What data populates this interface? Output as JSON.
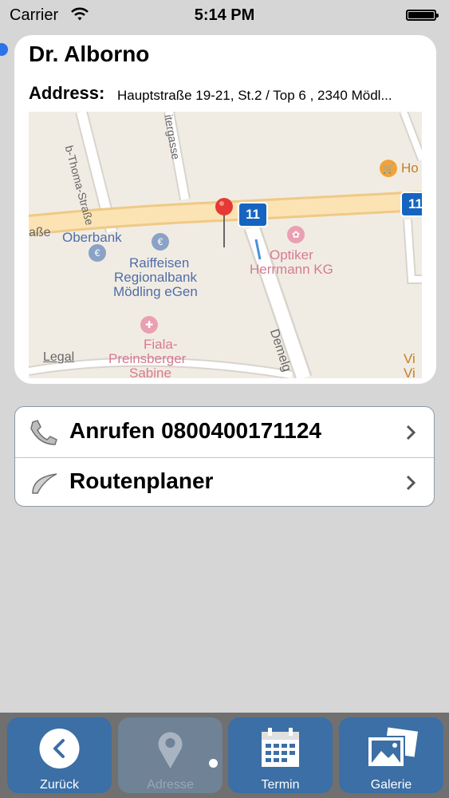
{
  "status_bar": {
    "carrier": "Carrier",
    "time": "5:14 PM"
  },
  "card": {
    "title": "Dr. Alborno",
    "address_label": "Address:",
    "address_value": "Hauptstraße 19-21, St.2 / Top 6 , 2340 Mödl..."
  },
  "map": {
    "labels": {
      "thoma_strasse": "b-Thoma-Straße",
      "gasse": "itergasse",
      "strasse_left": "aße",
      "oberbank": "Oberbank",
      "raiffeisen": "Raiffeisen",
      "regionalbank": "Regionalbank",
      "moedling": "Mödling eGen",
      "optiker": "Optiker",
      "herrmann": "Herrmann KG",
      "fiala": "Fiala-",
      "preinsberger": "Preinsberger",
      "sabine": "Sabine",
      "demel": "Demelg",
      "ho": "Ho",
      "vi1": "Vi",
      "vi2": "Vi",
      "legal": "Legal",
      "badge1": "11",
      "badge2": "11"
    }
  },
  "actions": {
    "call": "Anrufen 0800400171124",
    "route": "Routenplaner"
  },
  "tabbar": {
    "back": "Zurück",
    "address": "Adresse",
    "appointment": "Termin",
    "gallery": "Galerie"
  },
  "colors": {
    "tab_active": "#3b6fa5",
    "tab_disabled": "#6f8296",
    "accent": "#2a73e8"
  }
}
